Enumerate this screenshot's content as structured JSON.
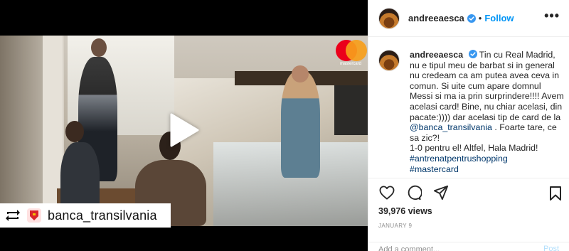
{
  "media": {
    "repost": {
      "username": "banca_transilvania"
    },
    "watermark": "mastercard"
  },
  "header": {
    "username": "andreeaesca",
    "separator": "•",
    "follow_label": "Follow",
    "more_label": "•••"
  },
  "caption": {
    "username": "andreeaesca",
    "line1": " Tin cu Real Madrid, nu e tipul meu de barbat si in general nu credeam ca am putea avea ceva in comun. Si uite cum apare domnul Messi si ma ia prin surprindere!!!! Avem acelasi card! Bine, nu chiar acelasi, din pacate:)))) dar acelasi tip de card de la ",
    "mention": "@banca_transilvania",
    "line2": " . Foarte tare, ce sa zic?!",
    "line3": "1-0 pentru el! Altfel, Hala Madrid!",
    "hashtag1": "#antrenatpentrushopping",
    "hashtag2": "#mastercard"
  },
  "stats": {
    "views": "39,976 views",
    "date": "JANUARY 9"
  },
  "comment": {
    "placeholder": "Add a comment...",
    "post_label": "Post"
  },
  "icons": {
    "like": "heart-icon",
    "comment": "comment-icon",
    "share": "share-icon",
    "save": "bookmark-icon",
    "verified": "verified-badge-icon",
    "repost": "repost-icon",
    "play": "play-icon"
  },
  "colors": {
    "link": "#00376b",
    "follow": "#0095f6",
    "verified": "#3897f0",
    "muted": "#8e8e8e"
  }
}
